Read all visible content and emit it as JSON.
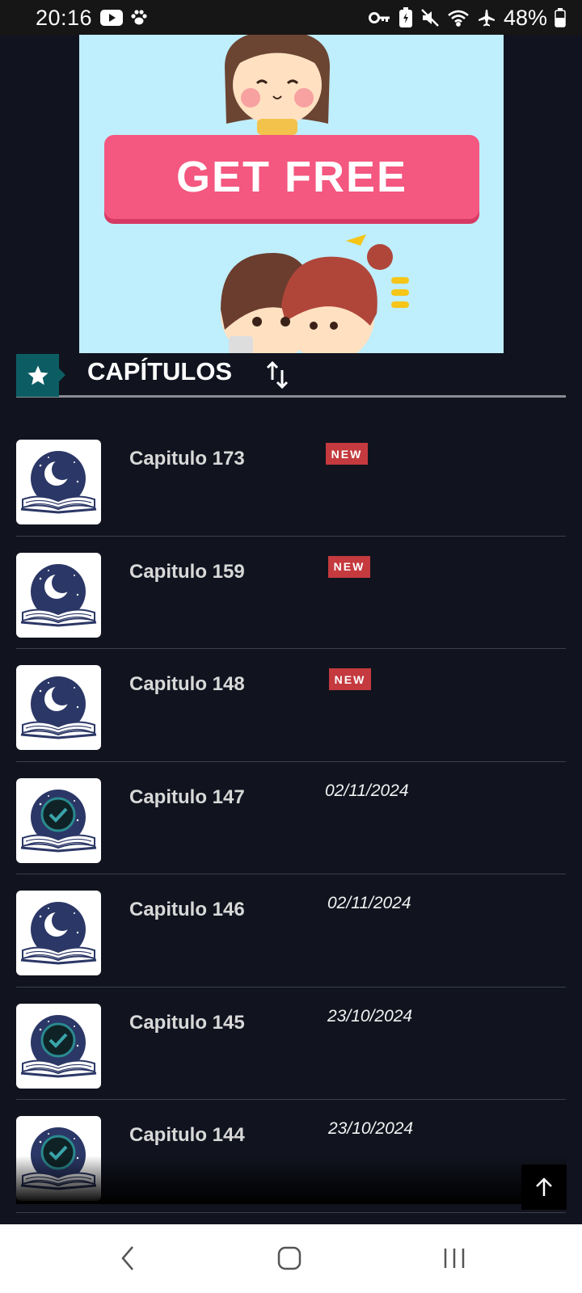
{
  "status_bar": {
    "time": "20:16",
    "battery": "48%",
    "icons": [
      "youtube-icon",
      "paw-icon",
      "key-icon",
      "battery-saver-icon",
      "mute-icon",
      "wifi-icon",
      "airplane-icon",
      "battery-icon"
    ]
  },
  "ad": {
    "button_label": "GET FREE"
  },
  "chapters": {
    "title": "CAPÍTULOS",
    "accent": "#0c5d63",
    "items": [
      {
        "title": "Capitulo 173",
        "badge": "NEW",
        "date": "",
        "read": false
      },
      {
        "title": "Capitulo 159",
        "badge": "NEW",
        "date": "",
        "read": false
      },
      {
        "title": "Capitulo 148",
        "badge": "NEW",
        "date": "",
        "read": false
      },
      {
        "title": "Capitulo 147",
        "badge": "",
        "date": "02/11/2024",
        "read": true
      },
      {
        "title": "Capitulo 146",
        "badge": "",
        "date": "02/11/2024",
        "read": false
      },
      {
        "title": "Capitulo 145",
        "badge": "",
        "date": "23/10/2024",
        "read": true
      },
      {
        "title": "Capitulo 144",
        "badge": "",
        "date": "23/10/2024",
        "read": true
      }
    ]
  },
  "nav": {
    "icons": [
      "back-icon",
      "home-icon",
      "recents-icon"
    ]
  }
}
